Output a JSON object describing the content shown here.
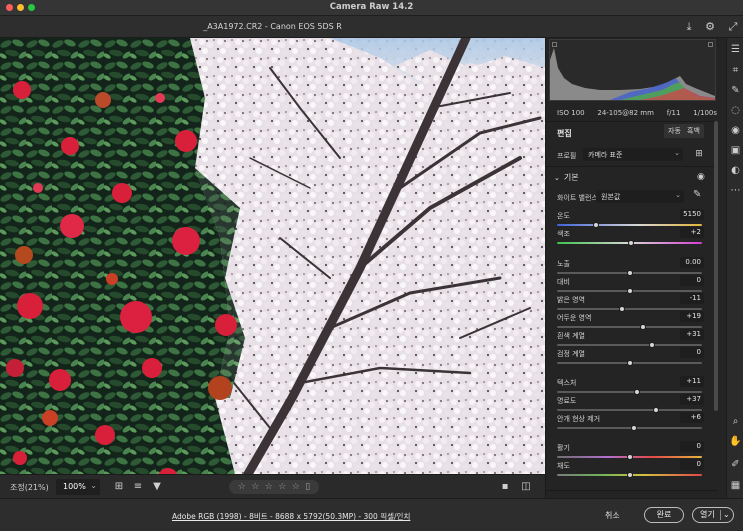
{
  "window": {
    "app_title": "Camera Raw 14.2"
  },
  "file": {
    "name": "_A3A1972.CR2  -  Canon EOS 5DS R"
  },
  "icons": {
    "save": "save-icon",
    "settings": "gear-icon",
    "fullscreen": "expand-icon"
  },
  "camera_info": {
    "iso": "ISO 100",
    "lens": "24-105@82 mm",
    "aperture": "f/11",
    "shutter": "1/100s"
  },
  "edit": {
    "title": "편집",
    "auto_label": "자동",
    "bw_label": "흑백",
    "profile_label": "프로필",
    "profile_value": "카메라 표준"
  },
  "basic": {
    "section_label": "기본",
    "wb_label": "화이트 밸런스",
    "wb_value": "원본값",
    "sliders": [
      {
        "label": "온도",
        "value": "5150",
        "pos": 0.27,
        "track": "temp"
      },
      {
        "label": "색조",
        "value": "+2",
        "pos": 0.51,
        "track": "tint"
      },
      {
        "label": "노출",
        "value": "0.00",
        "pos": 0.5,
        "track": "plain"
      },
      {
        "label": "대비",
        "value": "0",
        "pos": 0.5,
        "track": "plain"
      },
      {
        "label": "밝은 영역",
        "value": "-11",
        "pos": 0.445,
        "track": "plain"
      },
      {
        "label": "어두운 영역",
        "value": "+19",
        "pos": 0.595,
        "track": "plain"
      },
      {
        "label": "흰색 계열",
        "value": "+31",
        "pos": 0.655,
        "track": "plain"
      },
      {
        "label": "검정 계열",
        "value": "0",
        "pos": 0.5,
        "track": "plain"
      },
      {
        "label": "텍스처",
        "value": "+11",
        "pos": 0.555,
        "track": "plain"
      },
      {
        "label": "명료도",
        "value": "+37",
        "pos": 0.685,
        "track": "plain"
      },
      {
        "label": "안개 현상 제거",
        "value": "+6",
        "pos": 0.53,
        "track": "plain"
      },
      {
        "label": "활기",
        "value": "0",
        "pos": 0.5,
        "track": "vib"
      },
      {
        "label": "채도",
        "value": "0",
        "pos": 0.5,
        "track": "sat"
      }
    ]
  },
  "bottom_toolbar": {
    "zoom_label": "조정(21%)",
    "zoom_value": "100%",
    "stars": [
      "☆",
      "☆",
      "☆",
      "☆",
      "☆"
    ]
  },
  "status": {
    "workflow": "Adobe RGB (1998) - 8비트 - 8688 x 5792(50.3MP) - 300 픽셀/인치",
    "cancel_label": "취소",
    "done_label": "완료",
    "open_label": "열기"
  },
  "colors": {
    "panel_bg": "#242424",
    "accent_temp_blue": "#3d63d6",
    "accent_temp_yellow": "#e0b53a",
    "flower_red": "#d8203a",
    "blossom_white": "#efe9ee",
    "sky_blue": "#a9c7e6"
  }
}
